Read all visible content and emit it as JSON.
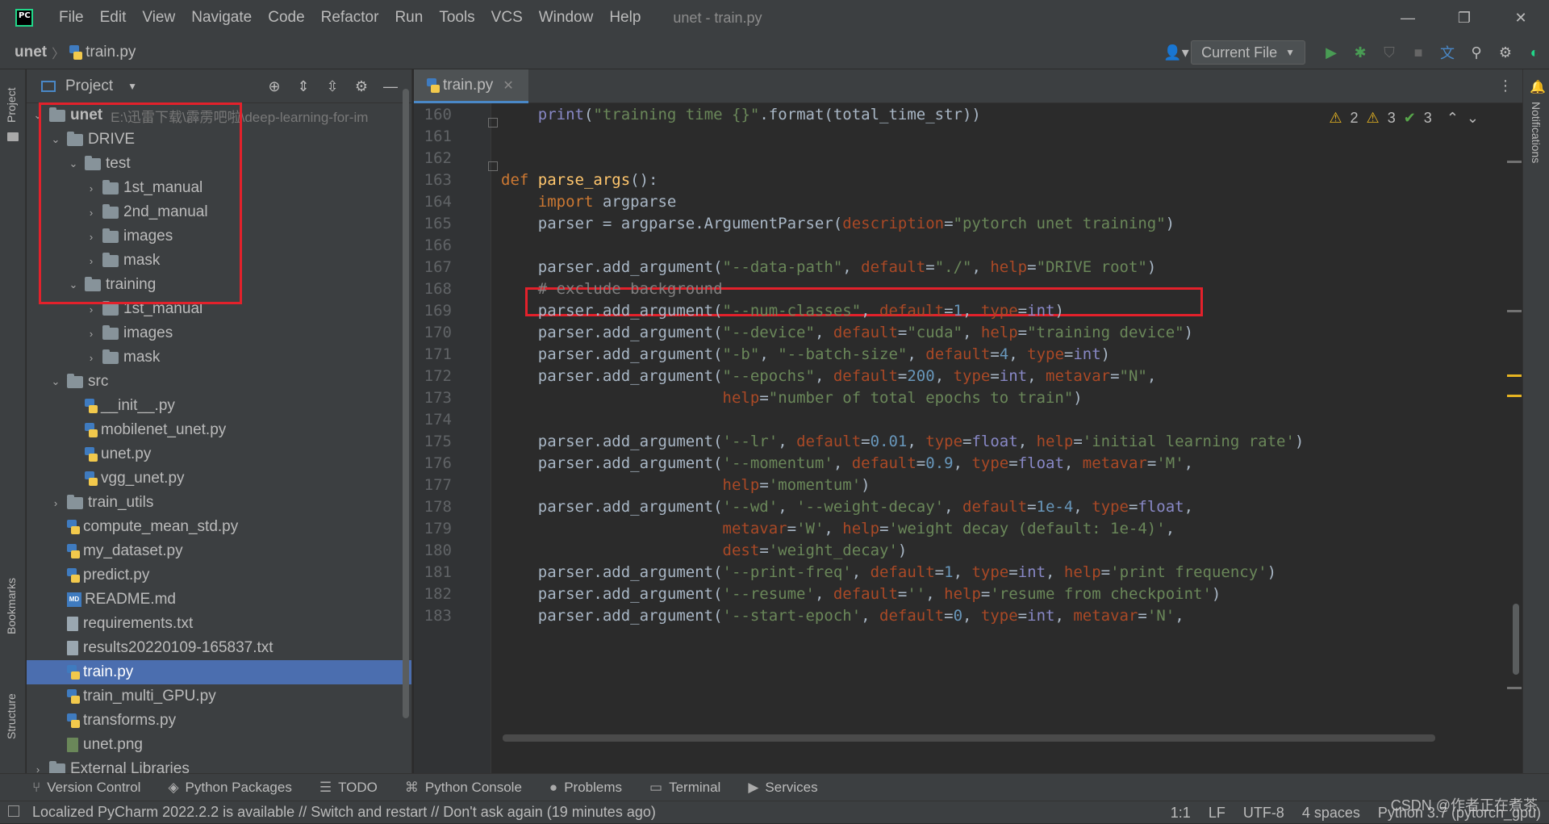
{
  "app": {
    "logo_text": "PC",
    "window_title": "unet - train.py"
  },
  "menu": [
    "File",
    "Edit",
    "View",
    "Navigate",
    "Code",
    "Refactor",
    "Run",
    "Tools",
    "VCS",
    "Window",
    "Help"
  ],
  "breadcrumb": {
    "project": "unet",
    "file": "train.py"
  },
  "run_config": {
    "label": "Current File"
  },
  "project_panel": {
    "title": "Project",
    "root": {
      "name": "unet",
      "path": "E:\\迅雷下载\\霹雳吧啦\\deep-learning-for-im"
    }
  },
  "tree": [
    {
      "name": "DRIVE",
      "kind": "folder",
      "depth": 1,
      "caret": "open"
    },
    {
      "name": "test",
      "kind": "folder",
      "depth": 2,
      "caret": "open"
    },
    {
      "name": "1st_manual",
      "kind": "folder",
      "depth": 3,
      "caret": "closed"
    },
    {
      "name": "2nd_manual",
      "kind": "folder",
      "depth": 3,
      "caret": "closed"
    },
    {
      "name": "images",
      "kind": "folder",
      "depth": 3,
      "caret": "closed"
    },
    {
      "name": "mask",
      "kind": "folder",
      "depth": 3,
      "caret": "closed"
    },
    {
      "name": "training",
      "kind": "folder",
      "depth": 2,
      "caret": "open"
    },
    {
      "name": "1st_manual",
      "kind": "folder",
      "depth": 3,
      "caret": "closed"
    },
    {
      "name": "images",
      "kind": "folder",
      "depth": 3,
      "caret": "closed"
    },
    {
      "name": "mask",
      "kind": "folder",
      "depth": 3,
      "caret": "closed"
    },
    {
      "name": "src",
      "kind": "folder",
      "depth": 1,
      "caret": "open"
    },
    {
      "name": "__init__.py",
      "kind": "py",
      "depth": 2,
      "caret": "none"
    },
    {
      "name": "mobilenet_unet.py",
      "kind": "py",
      "depth": 2,
      "caret": "none"
    },
    {
      "name": "unet.py",
      "kind": "py",
      "depth": 2,
      "caret": "none"
    },
    {
      "name": "vgg_unet.py",
      "kind": "py",
      "depth": 2,
      "caret": "none"
    },
    {
      "name": "train_utils",
      "kind": "folder",
      "depth": 1,
      "caret": "closed"
    },
    {
      "name": "compute_mean_std.py",
      "kind": "py",
      "depth": 1,
      "caret": "none"
    },
    {
      "name": "my_dataset.py",
      "kind": "py",
      "depth": 1,
      "caret": "none"
    },
    {
      "name": "predict.py",
      "kind": "py",
      "depth": 1,
      "caret": "none"
    },
    {
      "name": "README.md",
      "kind": "md",
      "depth": 1,
      "caret": "none"
    },
    {
      "name": "requirements.txt",
      "kind": "txt",
      "depth": 1,
      "caret": "none"
    },
    {
      "name": "results20220109-165837.txt",
      "kind": "txt",
      "depth": 1,
      "caret": "none"
    },
    {
      "name": "train.py",
      "kind": "py",
      "depth": 1,
      "caret": "none",
      "selected": true
    },
    {
      "name": "train_multi_GPU.py",
      "kind": "py",
      "depth": 1,
      "caret": "none"
    },
    {
      "name": "transforms.py",
      "kind": "py",
      "depth": 1,
      "caret": "none"
    },
    {
      "name": "unet.png",
      "kind": "png",
      "depth": 1,
      "caret": "none"
    },
    {
      "name": "External Libraries",
      "kind": "lib",
      "depth": 0,
      "caret": "closed"
    }
  ],
  "editor": {
    "tab": "train.py",
    "inspections": {
      "warn_a": "2",
      "warn_b": "3",
      "ok": "3"
    },
    "lines": [
      {
        "n": "160",
        "t": [
          [
            "",
            "    "
          ],
          [
            "bi",
            "print"
          ],
          [
            "",
            "("
          ],
          [
            "str",
            "\"training time {}\""
          ],
          [
            "",
            ".format(total_time_str))"
          ]
        ]
      },
      {
        "n": "161",
        "t": []
      },
      {
        "n": "162",
        "t": []
      },
      {
        "n": "163",
        "t": [
          [
            "kw",
            "def "
          ],
          [
            "fn",
            "parse_args"
          ],
          [
            "",
            "():"
          ]
        ]
      },
      {
        "n": "164",
        "t": [
          [
            "",
            "    "
          ],
          [
            "kw",
            "import "
          ],
          [
            "",
            "argparse"
          ]
        ]
      },
      {
        "n": "165",
        "t": [
          [
            "",
            "    parser = argparse.ArgumentParser("
          ],
          [
            "param",
            "description"
          ],
          [
            "",
            "="
          ],
          [
            "str",
            "\"pytorch unet training\""
          ],
          [
            "",
            ")"
          ]
        ]
      },
      {
        "n": "166",
        "t": []
      },
      {
        "n": "167",
        "t": [
          [
            "",
            "    parser.add_argument("
          ],
          [
            "str",
            "\"--data-path\""
          ],
          [
            "",
            ", "
          ],
          [
            "param",
            "default"
          ],
          [
            "",
            "="
          ],
          [
            "str",
            "\"./\""
          ],
          [
            "",
            ", "
          ],
          [
            "param",
            "help"
          ],
          [
            "",
            "="
          ],
          [
            "str",
            "\"DRIVE root\""
          ],
          [
            "",
            ")"
          ]
        ]
      },
      {
        "n": "168",
        "t": [
          [
            "",
            "    "
          ],
          [
            "cmt",
            "# exclude background"
          ]
        ]
      },
      {
        "n": "169",
        "t": [
          [
            "",
            "    parser.add_argument("
          ],
          [
            "str",
            "\"--num-classes\""
          ],
          [
            "",
            ", "
          ],
          [
            "param",
            "default"
          ],
          [
            "",
            "="
          ],
          [
            "num",
            "1"
          ],
          [
            "",
            ", "
          ],
          [
            "param",
            "type"
          ],
          [
            "",
            "="
          ],
          [
            "bi",
            "int"
          ],
          [
            "",
            ")"
          ]
        ]
      },
      {
        "n": "170",
        "t": [
          [
            "",
            "    parser.add_argument("
          ],
          [
            "str",
            "\"--device\""
          ],
          [
            "",
            ", "
          ],
          [
            "param",
            "default"
          ],
          [
            "",
            "="
          ],
          [
            "str",
            "\"cuda\""
          ],
          [
            "",
            ", "
          ],
          [
            "param",
            "help"
          ],
          [
            "",
            "="
          ],
          [
            "str",
            "\"training device\""
          ],
          [
            "",
            ")"
          ]
        ]
      },
      {
        "n": "171",
        "t": [
          [
            "",
            "    parser.add_argument("
          ],
          [
            "str",
            "\"-b\""
          ],
          [
            "",
            ", "
          ],
          [
            "str",
            "\"--batch-size\""
          ],
          [
            "",
            ", "
          ],
          [
            "param",
            "default"
          ],
          [
            "",
            "="
          ],
          [
            "num",
            "4"
          ],
          [
            "",
            ", "
          ],
          [
            "param",
            "type"
          ],
          [
            "",
            "="
          ],
          [
            "bi",
            "int"
          ],
          [
            "",
            ")"
          ]
        ]
      },
      {
        "n": "172",
        "t": [
          [
            "",
            "    parser.add_argument("
          ],
          [
            "str",
            "\"--epochs\""
          ],
          [
            "",
            ", "
          ],
          [
            "param",
            "default"
          ],
          [
            "",
            "="
          ],
          [
            "num",
            "200"
          ],
          [
            "",
            ", "
          ],
          [
            "param",
            "type"
          ],
          [
            "",
            "="
          ],
          [
            "bi",
            "int"
          ],
          [
            "",
            ", "
          ],
          [
            "param",
            "metavar"
          ],
          [
            "",
            "="
          ],
          [
            "str",
            "\"N\""
          ],
          [
            "",
            ","
          ]
        ]
      },
      {
        "n": "173",
        "t": [
          [
            "",
            "                        "
          ],
          [
            "param",
            "help"
          ],
          [
            "",
            "="
          ],
          [
            "str",
            "\"number of total epochs to train\""
          ],
          [
            "",
            ")"
          ]
        ]
      },
      {
        "n": "174",
        "t": []
      },
      {
        "n": "175",
        "t": [
          [
            "",
            "    parser.add_argument("
          ],
          [
            "str",
            "'--lr'"
          ],
          [
            "",
            ", "
          ],
          [
            "param",
            "default"
          ],
          [
            "",
            "="
          ],
          [
            "num",
            "0.01"
          ],
          [
            "",
            ", "
          ],
          [
            "param",
            "type"
          ],
          [
            "",
            "="
          ],
          [
            "bi",
            "float"
          ],
          [
            "",
            ", "
          ],
          [
            "param",
            "help"
          ],
          [
            "",
            "="
          ],
          [
            "str",
            "'initial learning rate'"
          ],
          [
            "",
            ")"
          ]
        ]
      },
      {
        "n": "176",
        "t": [
          [
            "",
            "    parser.add_argument("
          ],
          [
            "str",
            "'--momentum'"
          ],
          [
            "",
            ", "
          ],
          [
            "param",
            "default"
          ],
          [
            "",
            "="
          ],
          [
            "num",
            "0.9"
          ],
          [
            "",
            ", "
          ],
          [
            "param",
            "type"
          ],
          [
            "",
            "="
          ],
          [
            "bi",
            "float"
          ],
          [
            "",
            ", "
          ],
          [
            "param",
            "metavar"
          ],
          [
            "",
            "="
          ],
          [
            "str",
            "'M'"
          ],
          [
            "",
            ","
          ]
        ]
      },
      {
        "n": "177",
        "t": [
          [
            "",
            "                        "
          ],
          [
            "param",
            "help"
          ],
          [
            "",
            "="
          ],
          [
            "str",
            "'momentum'"
          ],
          [
            "",
            ")"
          ]
        ]
      },
      {
        "n": "178",
        "t": [
          [
            "",
            "    parser.add_argument("
          ],
          [
            "str",
            "'--wd'"
          ],
          [
            "",
            ", "
          ],
          [
            "str",
            "'--weight-decay'"
          ],
          [
            "",
            ", "
          ],
          [
            "param",
            "default"
          ],
          [
            "",
            "="
          ],
          [
            "num",
            "1e-4"
          ],
          [
            "",
            ", "
          ],
          [
            "param",
            "type"
          ],
          [
            "",
            "="
          ],
          [
            "bi",
            "float"
          ],
          [
            "",
            ","
          ]
        ]
      },
      {
        "n": "179",
        "t": [
          [
            "",
            "                        "
          ],
          [
            "param",
            "metavar"
          ],
          [
            "",
            "="
          ],
          [
            "str",
            "'W'"
          ],
          [
            "",
            ", "
          ],
          [
            "param",
            "help"
          ],
          [
            "",
            "="
          ],
          [
            "str",
            "'weight decay (default: 1e-4)'"
          ],
          [
            "",
            ","
          ]
        ]
      },
      {
        "n": "180",
        "t": [
          [
            "",
            "                        "
          ],
          [
            "param",
            "dest"
          ],
          [
            "",
            "="
          ],
          [
            "str",
            "'weight_decay'"
          ],
          [
            "",
            ")"
          ]
        ]
      },
      {
        "n": "181",
        "t": [
          [
            "",
            "    parser.add_argument("
          ],
          [
            "str",
            "'--print-freq'"
          ],
          [
            "",
            ", "
          ],
          [
            "param",
            "default"
          ],
          [
            "",
            "="
          ],
          [
            "num",
            "1"
          ],
          [
            "",
            ", "
          ],
          [
            "param",
            "type"
          ],
          [
            "",
            "="
          ],
          [
            "bi",
            "int"
          ],
          [
            "",
            ", "
          ],
          [
            "param",
            "help"
          ],
          [
            "",
            "="
          ],
          [
            "str",
            "'print frequency'"
          ],
          [
            "",
            ")"
          ]
        ]
      },
      {
        "n": "182",
        "t": [
          [
            "",
            "    parser.add_argument("
          ],
          [
            "str",
            "'--resume'"
          ],
          [
            "",
            ", "
          ],
          [
            "param",
            "default"
          ],
          [
            "",
            "="
          ],
          [
            "str",
            "''"
          ],
          [
            "",
            ", "
          ],
          [
            "param",
            "help"
          ],
          [
            "",
            "="
          ],
          [
            "str",
            "'resume from checkpoint'"
          ],
          [
            "",
            ")"
          ]
        ]
      },
      {
        "n": "183",
        "t": [
          [
            "",
            "    parser.add_argument("
          ],
          [
            "str",
            "'--start-epoch'"
          ],
          [
            "",
            ", "
          ],
          [
            "param",
            "default"
          ],
          [
            "",
            "="
          ],
          [
            "num",
            "0"
          ],
          [
            "",
            ", "
          ],
          [
            "param",
            "type"
          ],
          [
            "",
            "="
          ],
          [
            "bi",
            "int"
          ],
          [
            "",
            ", "
          ],
          [
            "param",
            "metavar"
          ],
          [
            "",
            "="
          ],
          [
            "str",
            "'N'"
          ],
          [
            "",
            ","
          ]
        ]
      }
    ]
  },
  "stripes": {
    "project": "Project",
    "bookmarks": "Bookmarks",
    "structure": "Structure",
    "notifications": "Notifications"
  },
  "tool_tabs": [
    "Version Control",
    "Python Packages",
    "TODO",
    "Python Console",
    "Problems",
    "Terminal",
    "Services"
  ],
  "status": {
    "message": "Localized PyCharm 2022.2.2 is available // Switch and restart // Don't ask again (19 minutes ago)",
    "position": "1:1",
    "line_sep": "LF",
    "encoding": "UTF-8",
    "indent": "4 spaces",
    "interpreter": "Python 3.7 (pytorch_gpu)"
  },
  "watermark": "CSDN @作者正在煮茶",
  "colors": {
    "accent": "#4a88c7",
    "selection": "#4b6eaf",
    "highlight_box": "#e3212b",
    "warning": "#e6b422",
    "ok": "#57a64a"
  }
}
